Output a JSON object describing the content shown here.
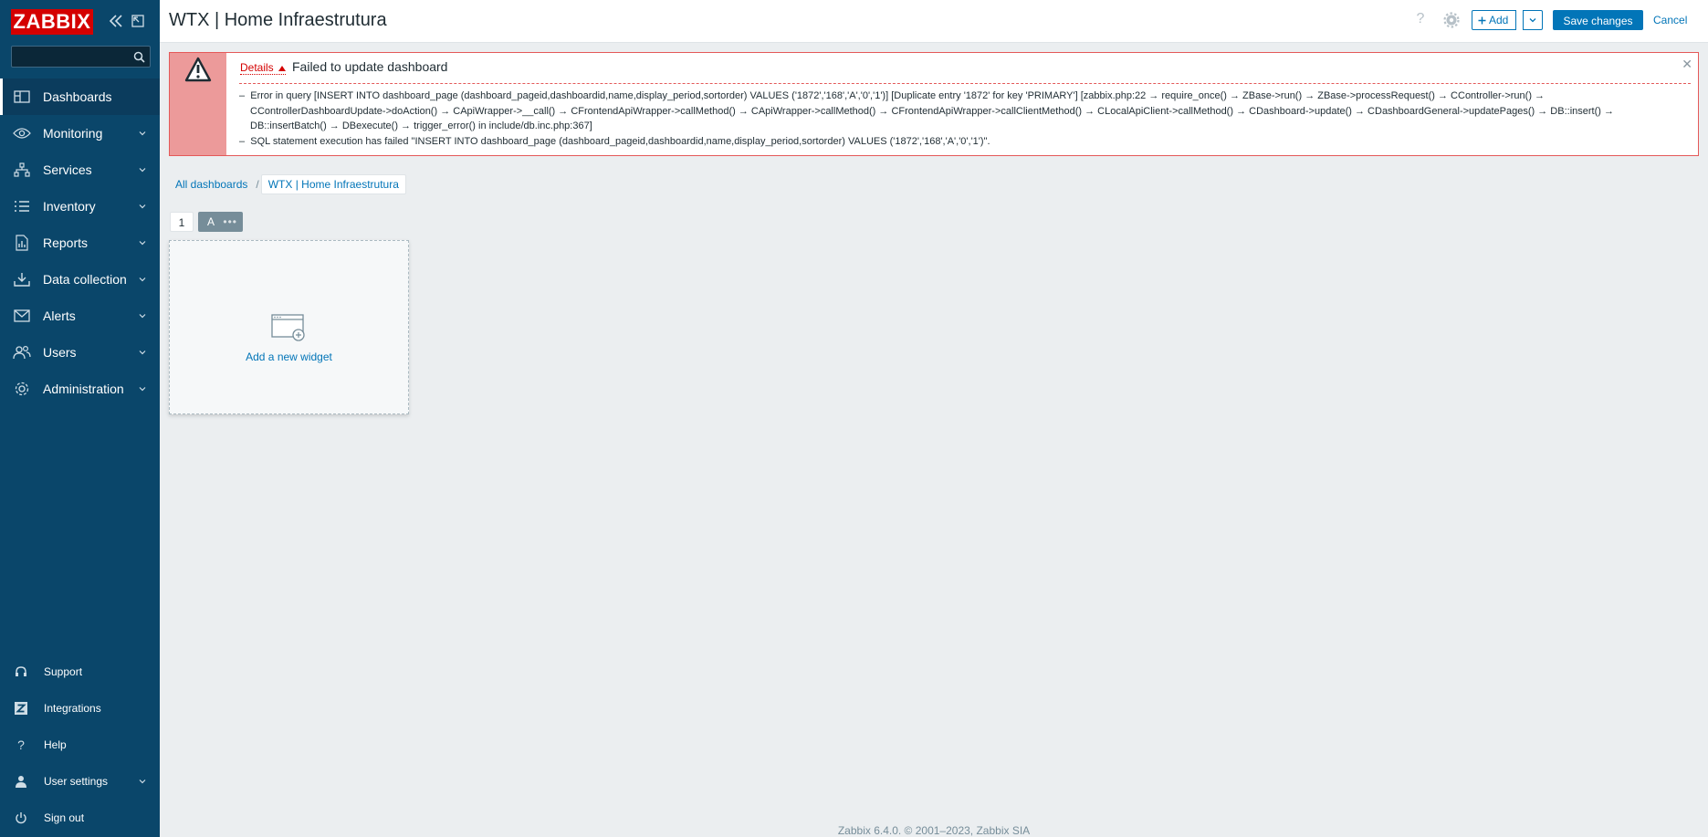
{
  "sidebar": {
    "logo": "ZABBIX",
    "search_placeholder": "",
    "items": [
      {
        "label": "Dashboards",
        "icon": "dashboard-icon"
      },
      {
        "label": "Monitoring",
        "icon": "eye-icon"
      },
      {
        "label": "Services",
        "icon": "services-icon"
      },
      {
        "label": "Inventory",
        "icon": "list-icon"
      },
      {
        "label": "Reports",
        "icon": "report-icon"
      },
      {
        "label": "Data collection",
        "icon": "download-icon"
      },
      {
        "label": "Alerts",
        "icon": "envelope-icon"
      },
      {
        "label": "Users",
        "icon": "users-icon"
      },
      {
        "label": "Administration",
        "icon": "gear-icon"
      }
    ],
    "bottom_items": [
      {
        "label": "Support",
        "icon": "headset-icon"
      },
      {
        "label": "Integrations",
        "icon": "zabbix-z-icon"
      },
      {
        "label": "Help",
        "icon": "question-icon"
      },
      {
        "label": "User settings",
        "icon": "user-icon"
      },
      {
        "label": "Sign out",
        "icon": "power-icon"
      }
    ]
  },
  "header": {
    "title": "WTX | Home Infraestrutura",
    "add_label": "Add",
    "save_label": "Save changes",
    "cancel_label": "Cancel",
    "help_label": "?"
  },
  "error": {
    "details_label": "Details",
    "title": "Failed to update dashboard",
    "lines": [
      "Error in query [INSERT INTO dashboard_page (dashboard_pageid,dashboardid,name,display_period,sortorder) VALUES ('1872','168','A','0','1')] [Duplicate entry '1872' for key 'PRIMARY'] [zabbix.php:22 → require_once() → ZBase->run() → ZBase->processRequest() → CController->run() → CControllerDashboardUpdate->doAction() → CApiWrapper->__call() → CFrontendApiWrapper->callMethod() → CApiWrapper->callMethod() → CFrontendApiWrapper->callClientMethod() → CLocalApiClient->callMethod() → CDashboard->update() → CDashboardGeneral->updatePages() → DB::insert() → DB::insertBatch() → DBexecute() → trigger_error() in include/db.inc.php:367]",
      "SQL statement execution has failed \"INSERT INTO dashboard_page (dashboard_pageid,dashboardid,name,display_period,sortorder) VALUES ('1872','168','A','0','1')\"."
    ]
  },
  "breadcrumb": {
    "all": "All dashboards",
    "current": "WTX | Home Infraestrutura"
  },
  "pages": [
    "1",
    "A"
  ],
  "widget": {
    "add_label": "Add a new widget"
  },
  "footer": "Zabbix 6.4.0. © 2001–2023, Zabbix SIA",
  "colors": {
    "sidebar": "#0a466a",
    "accent": "#0275b8",
    "error_border": "#e45959",
    "error_side": "#ec9a9a",
    "logo": "#d40000"
  }
}
